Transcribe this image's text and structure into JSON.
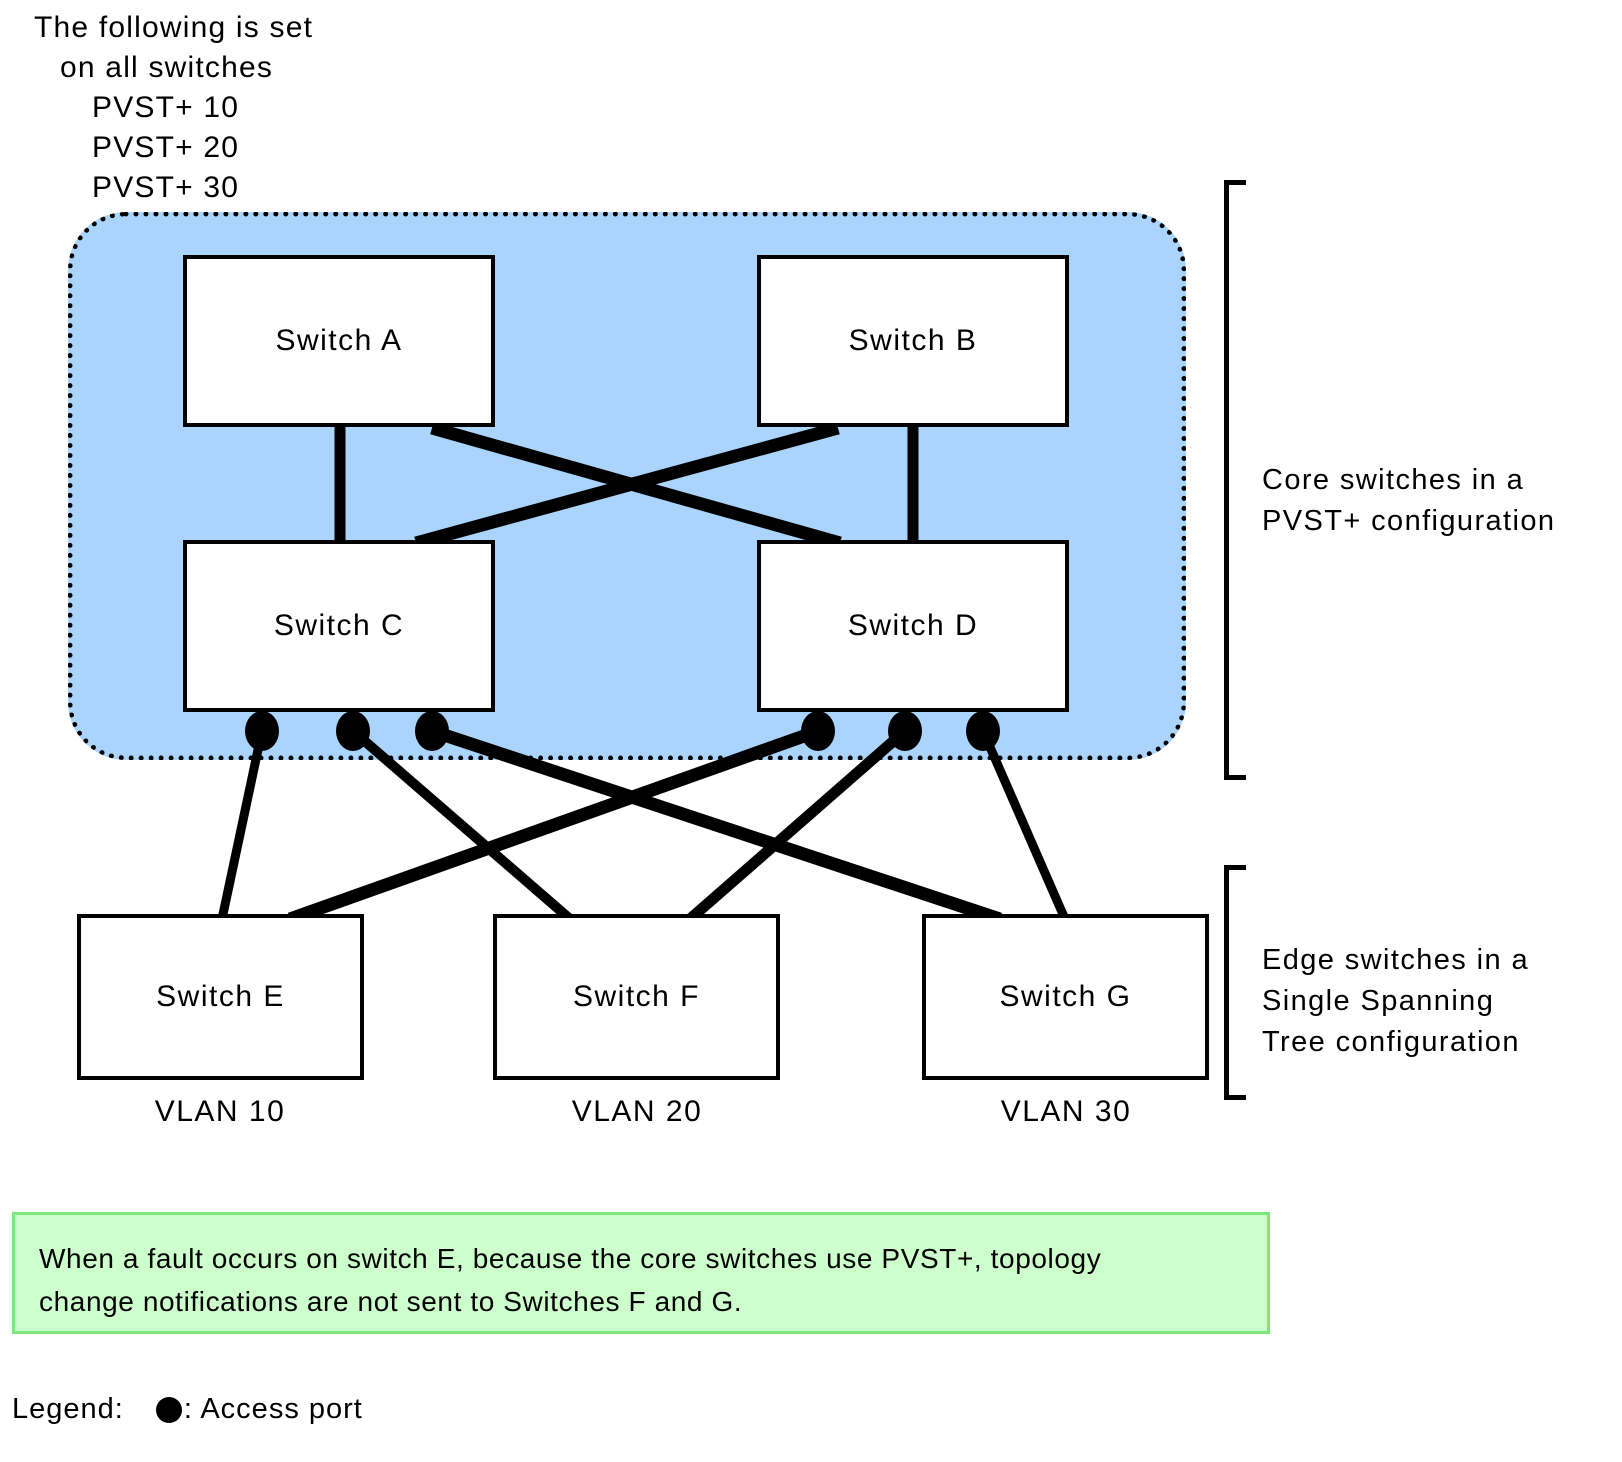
{
  "header_note": {
    "lines": [
      "The following is set",
      "on all switches",
      "PVST+ 10",
      "PVST+ 20",
      "PVST+ 30"
    ]
  },
  "colors": {
    "core_region_fill": "#aad4fb",
    "note_box_fill": "#ccffcc",
    "note_box_border": "#7ce87c",
    "line": "#000000"
  },
  "core_switches": [
    {
      "id": "switch-a",
      "label": "Switch A"
    },
    {
      "id": "switch-b",
      "label": "Switch B"
    },
    {
      "id": "switch-c",
      "label": "Switch C"
    },
    {
      "id": "switch-d",
      "label": "Switch D"
    }
  ],
  "edge_switches": [
    {
      "id": "switch-e",
      "label": "Switch E",
      "vlan": "VLAN 10"
    },
    {
      "id": "switch-f",
      "label": "Switch F",
      "vlan": "VLAN 20"
    },
    {
      "id": "switch-g",
      "label": "Switch G",
      "vlan": "VLAN 30"
    }
  ],
  "annotations": {
    "core": "Core switches in a\nPVST+ configuration",
    "edge": "Edge switches in a\nSingle Spanning\nTree configuration"
  },
  "note_box": {
    "line1": "When a fault occurs on switch E, because the core switches use PVST+, topology",
    "line2": "change notifications are not sent to Switches F and G."
  },
  "legend": {
    "title": "Legend:",
    "symbol": "●",
    "text": ": Access port"
  },
  "access_ports": {
    "count": 6,
    "label": "Access port"
  }
}
